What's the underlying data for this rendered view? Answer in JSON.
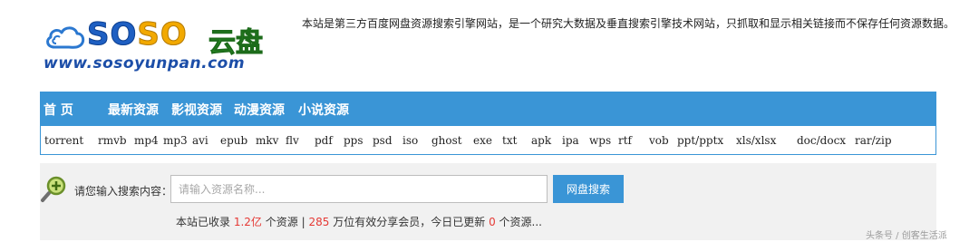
{
  "logo": {
    "text_s1": "SO",
    "text_s2": "SO",
    "text_cn": "云盘",
    "url": "www.sosoyunpan.com"
  },
  "notice": "本站是第三方百度网盘资源搜索引擎网站，是一个研究大数据及垂直搜索引擎技术网站，只抓取和显示相关链接而不保存任何资源数据。",
  "nav": {
    "items": [
      "首 页",
      "最新资源",
      "影视资源",
      "动漫资源",
      "小说资源"
    ]
  },
  "formats": [
    "torrent",
    "rmvb",
    "mp4",
    "mp3",
    "avi",
    "epub",
    "mkv",
    "flv",
    "pdf",
    "pps",
    "psd",
    "iso",
    "ghost",
    "exe",
    "txt",
    "apk",
    "ipa",
    "wps",
    "rtf",
    "vob",
    "ppt/pptx",
    "xls/xlsx",
    "doc/docx",
    "rar/zip"
  ],
  "search": {
    "label": "请您输入搜索内容：",
    "placeholder": "请输入资源名称...",
    "button": "网盘搜索"
  },
  "stats": {
    "prefix": "本站已收录",
    "resource_count": "1.2亿",
    "resource_unit": "个资源",
    "separator": "|",
    "member_count": "285",
    "member_text": "万位有效分享会员，今日已更新",
    "today_count": "0",
    "today_text": "个资源..."
  },
  "watermark": "头条号 / 创客生活派",
  "colors": {
    "accent": "#3a95d6",
    "highlight": "#e53935"
  },
  "icons": [
    "cloud-logo-icon",
    "magnifier-plus-icon"
  ]
}
